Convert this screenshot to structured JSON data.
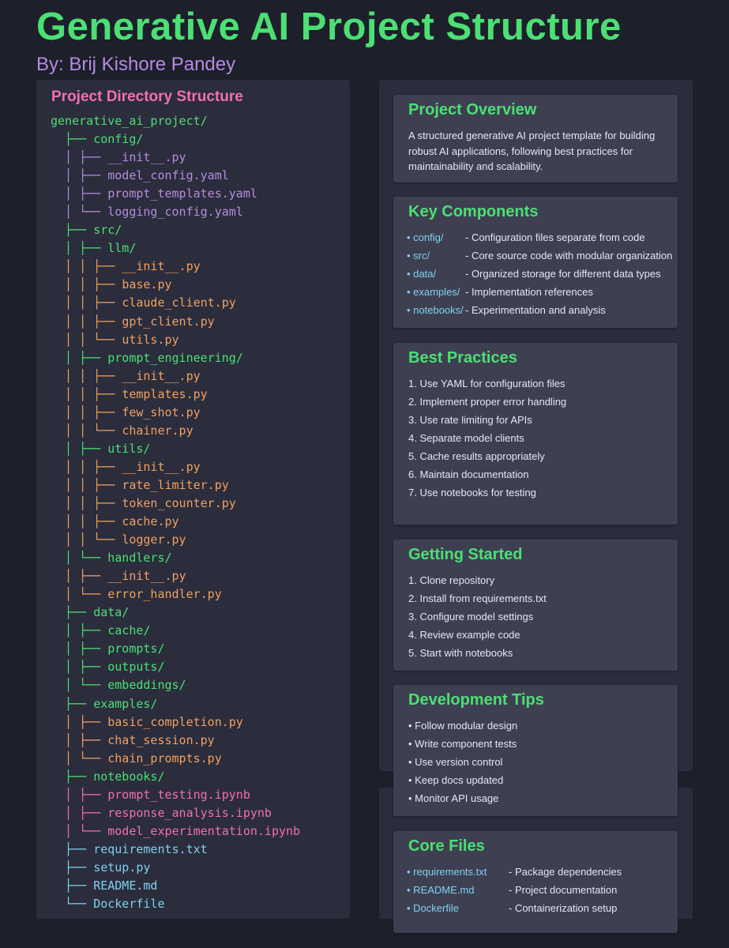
{
  "header": {
    "title": "Generative AI Project Structure",
    "author": "By: Brij Kishore Pandey"
  },
  "directory": {
    "heading": "Project Directory Structure",
    "lines": [
      {
        "prefix": "",
        "name": "generative_ai_project/",
        "color": "green"
      },
      {
        "prefix": "  ├── ",
        "name": "config/",
        "color": "green"
      },
      {
        "prefix": "  │ ├── ",
        "name": "__init__.py",
        "color": "purple"
      },
      {
        "prefix": "  │ ├── ",
        "name": "model_config.yaml",
        "color": "purple"
      },
      {
        "prefix": "  │ ├── ",
        "name": "prompt_templates.yaml",
        "color": "purple"
      },
      {
        "prefix": "  │ └── ",
        "name": "logging_config.yaml",
        "color": "purple"
      },
      {
        "prefix": "  ├── ",
        "name": "src/",
        "color": "green"
      },
      {
        "prefix": "  │ ├── ",
        "name": "llm/",
        "color": "green"
      },
      {
        "prefix": "  │ │ ├── ",
        "name": "__init__.py",
        "color": "orange"
      },
      {
        "prefix": "  │ │ ├── ",
        "name": "base.py",
        "color": "orange"
      },
      {
        "prefix": "  │ │ ├── ",
        "name": "claude_client.py",
        "color": "orange"
      },
      {
        "prefix": "  │ │ ├── ",
        "name": "gpt_client.py",
        "color": "orange"
      },
      {
        "prefix": "  │ │ └── ",
        "name": "utils.py",
        "color": "orange"
      },
      {
        "prefix": "  │ ├── ",
        "name": "prompt_engineering/",
        "color": "green"
      },
      {
        "prefix": "  │ │ ├── ",
        "name": "__init__.py",
        "color": "orange"
      },
      {
        "prefix": "  │ │ ├── ",
        "name": "templates.py",
        "color": "orange"
      },
      {
        "prefix": "  │ │ ├── ",
        "name": "few_shot.py",
        "color": "orange"
      },
      {
        "prefix": "  │ │ └── ",
        "name": "chainer.py",
        "color": "orange"
      },
      {
        "prefix": "  │ ├── ",
        "name": "utils/",
        "color": "green"
      },
      {
        "prefix": "  │ │ ├── ",
        "name": "__init__.py",
        "color": "orange"
      },
      {
        "prefix": "  │ │ ├── ",
        "name": "rate_limiter.py",
        "color": "orange"
      },
      {
        "prefix": "  │ │ ├── ",
        "name": "token_counter.py",
        "color": "orange"
      },
      {
        "prefix": "  │ │ ├── ",
        "name": "cache.py",
        "color": "orange"
      },
      {
        "prefix": "  │ │ └── ",
        "name": "logger.py",
        "color": "orange"
      },
      {
        "prefix": "  │ └── ",
        "name": "handlers/",
        "color": "green"
      },
      {
        "prefix": "  │ ├── ",
        "name": "__init__.py",
        "color": "orange"
      },
      {
        "prefix": "  │ └── ",
        "name": "error_handler.py",
        "color": "orange"
      },
      {
        "prefix": "  ├── ",
        "name": "data/",
        "color": "green"
      },
      {
        "prefix": "  │ ├── ",
        "name": "cache/",
        "color": "green"
      },
      {
        "prefix": "  │ ├── ",
        "name": "prompts/",
        "color": "green"
      },
      {
        "prefix": "  │ ├── ",
        "name": "outputs/",
        "color": "green"
      },
      {
        "prefix": "  │ └── ",
        "name": "embeddings/",
        "color": "green"
      },
      {
        "prefix": "  ├── ",
        "name": "examples/",
        "color": "green"
      },
      {
        "prefix": "  │ ├── ",
        "name": "basic_completion.py",
        "color": "orange"
      },
      {
        "prefix": "  │ ├── ",
        "name": "chat_session.py",
        "color": "orange"
      },
      {
        "prefix": "  │ └── ",
        "name": "chain_prompts.py",
        "color": "orange"
      },
      {
        "prefix": "  ├── ",
        "name": "notebooks/",
        "color": "green"
      },
      {
        "prefix": "  │ ├── ",
        "name": "prompt_testing.ipynb",
        "color": "pink"
      },
      {
        "prefix": "  │ ├── ",
        "name": "response_analysis.ipynb",
        "color": "pink"
      },
      {
        "prefix": "  │ └── ",
        "name": "model_experimentation.ipynb",
        "color": "pink"
      },
      {
        "prefix": "  ├── ",
        "name": "requirements.txt",
        "color": "cyan"
      },
      {
        "prefix": "  ├── ",
        "name": "setup.py",
        "color": "cyan"
      },
      {
        "prefix": "  ├── ",
        "name": "README.md",
        "color": "cyan"
      },
      {
        "prefix": "  └── ",
        "name": "Dockerfile",
        "color": "cyan"
      }
    ]
  },
  "overview": {
    "title": "Project Overview",
    "text": "A structured generative AI project template for building robust AI applications, following best practices for maintainability and scalability."
  },
  "key_components": {
    "title": "Key Components",
    "items": [
      {
        "key": "• config/",
        "desc": "- Configuration files separate from code"
      },
      {
        "key": "• src/",
        "desc": "- Core source code with modular organization"
      },
      {
        "key": "• data/",
        "desc": "- Organized storage for different data types"
      },
      {
        "key": "• examples/",
        "desc": "- Implementation references"
      },
      {
        "key": "• notebooks/",
        "desc": "- Experimentation and analysis"
      }
    ]
  },
  "best_practices": {
    "title": "Best Practices",
    "items": [
      "1. Use YAML for configuration files",
      "2. Implement proper error handling",
      "3. Use rate limiting for APIs",
      "4. Separate model clients",
      "5. Cache results appropriately",
      "6. Maintain documentation",
      "7. Use notebooks for testing"
    ]
  },
  "getting_started": {
    "title": "Getting Started",
    "items": [
      "1. Clone repository",
      "2. Install from requirements.txt",
      "3. Configure model settings",
      "4. Review example code",
      "5. Start with notebooks"
    ]
  },
  "dev_tips": {
    "title": "Development Tips",
    "items": [
      "• Follow modular design",
      "• Write component tests",
      "• Use version control",
      "• Keep docs updated",
      "• Monitor API usage"
    ]
  },
  "core_files": {
    "title": "Core Files",
    "items": [
      {
        "key": "• requirements.txt",
        "desc": "- Package dependencies"
      },
      {
        "key": "• README.md",
        "desc": "- Project documentation"
      },
      {
        "key": "• Dockerfile",
        "desc": "- Containerization setup"
      }
    ]
  }
}
